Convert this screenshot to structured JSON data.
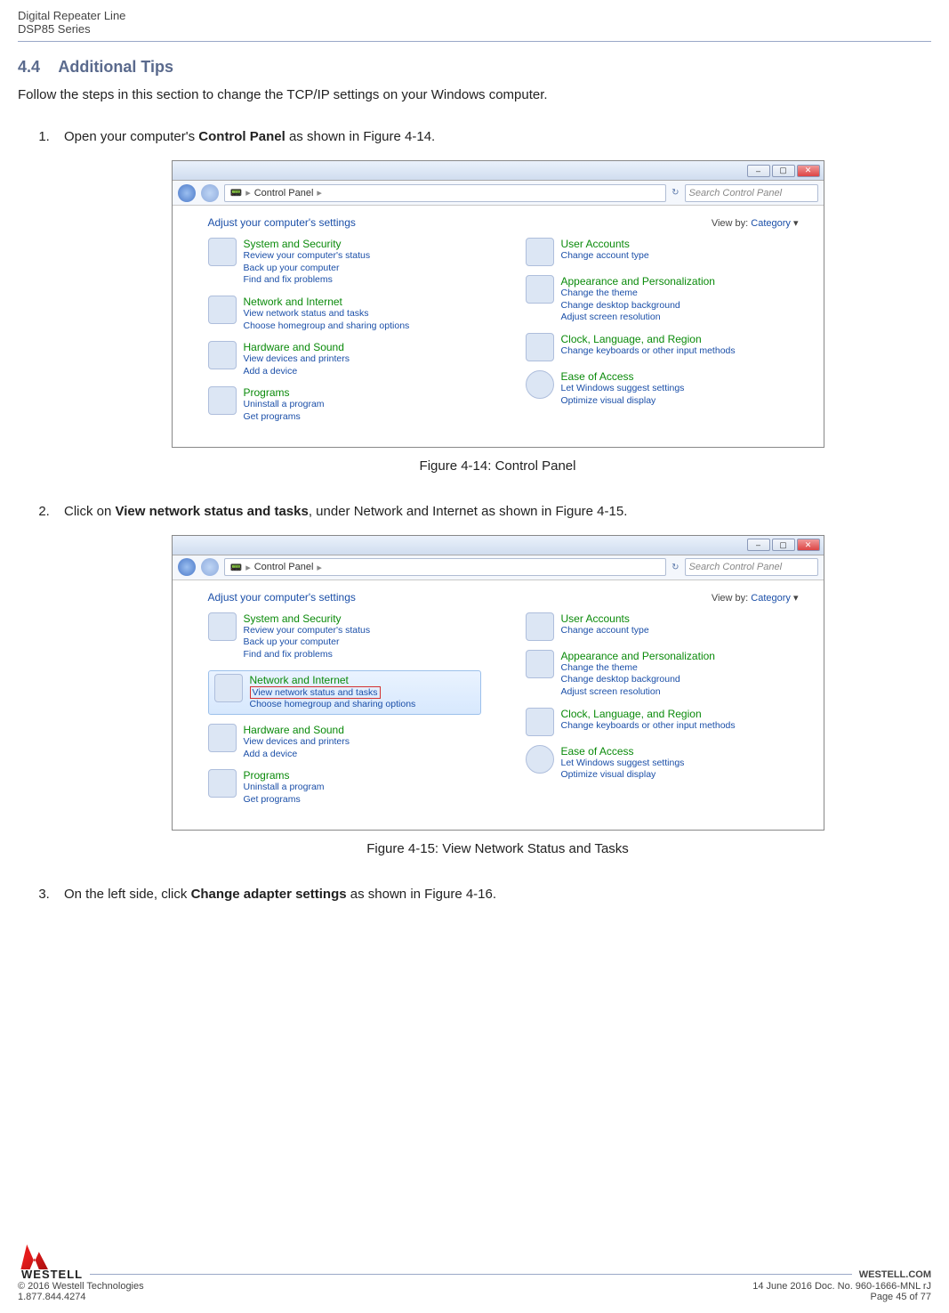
{
  "header": {
    "line1": "Digital Repeater Line",
    "line2": "DSP85 Series"
  },
  "section": {
    "number": "4.4",
    "title": "Additional Tips",
    "intro": "Follow the steps in this section to change the TCP/IP settings on your Windows computer."
  },
  "steps": [
    {
      "pre": "Open your computer's ",
      "bold": "Control Panel",
      "post": " as shown in Figure 4-14."
    },
    {
      "pre": "Click on ",
      "bold": "View network status and tasks",
      "post": ", under Network and Internet as shown in Figure 4-15."
    },
    {
      "pre": "On the left side, click ",
      "bold": "Change adapter settings",
      "post": " as shown in Figure 4-16."
    }
  ],
  "captions": {
    "fig414": "Figure 4-14: Control Panel",
    "fig415": "Figure 4-15: View Network Status and Tasks"
  },
  "controlPanel": {
    "breadcrumb_icon": "📟",
    "breadcrumb": "Control Panel",
    "search_placeholder": "Search Control Panel",
    "adjust": "Adjust your computer's settings",
    "viewby_label": "View by:",
    "viewby_value": "Category",
    "left": [
      {
        "title": "System and Security",
        "subs": [
          "Review your computer's status",
          "Back up your computer",
          "Find and fix problems"
        ]
      },
      {
        "title": "Network and Internet",
        "subs": [
          "View network status and tasks",
          "Choose homegroup and sharing options"
        ]
      },
      {
        "title": "Hardware and Sound",
        "subs": [
          "View devices and printers",
          "Add a device"
        ]
      },
      {
        "title": "Programs",
        "subs": [
          "Uninstall a program",
          "Get programs"
        ]
      }
    ],
    "right": [
      {
        "title": "User Accounts",
        "subs": [
          "Change account type"
        ]
      },
      {
        "title": "Appearance and Personalization",
        "subs": [
          "Change the theme",
          "Change desktop background",
          "Adjust screen resolution"
        ]
      },
      {
        "title": "Clock, Language, and Region",
        "subs": [
          "Change keyboards or other input methods"
        ]
      },
      {
        "title": "Ease of Access",
        "subs": [
          "Let Windows suggest settings",
          "Optimize visual display"
        ]
      }
    ]
  },
  "footer": {
    "brand": "WESTELL",
    "url": "WESTELL.COM",
    "copyright": "© 2016 Westell Technologies",
    "docinfo": "14 June 2016 Doc. No. 960-1666-MNL rJ",
    "phone": "1.877.844.4274",
    "page": "Page 45 of 77"
  }
}
